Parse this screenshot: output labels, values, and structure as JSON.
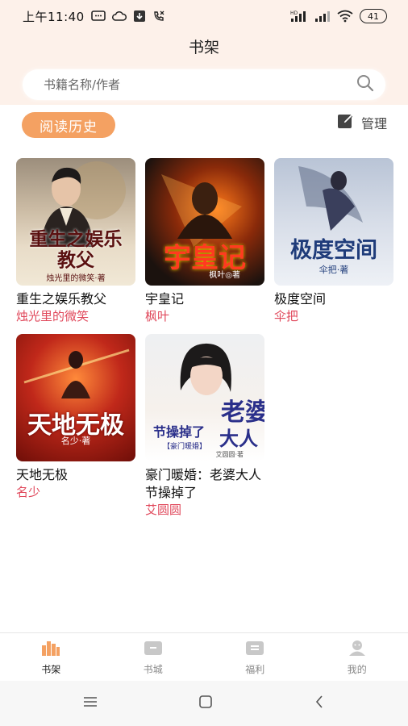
{
  "status_bar": {
    "time": "上午11:40",
    "network_label": "HD",
    "battery": "41"
  },
  "page_title": "书架",
  "search": {
    "placeholder": "书籍名称/作者"
  },
  "history_button": "阅读历史",
  "manage_button": "管理",
  "books": [
    {
      "title": "重生之娱乐教父",
      "author": "烛光里的微笑",
      "cover_title": "重生之娱乐教父",
      "cover_author": "烛光里的微笑·著"
    },
    {
      "title": "宇皇记",
      "author": "枫叶",
      "cover_title": "宇皇记",
      "cover_author": "枫叶◎著"
    },
    {
      "title": "极度空间",
      "author": "伞把",
      "cover_title": "极度空间",
      "cover_author": "伞把·著"
    },
    {
      "title": "天地无极",
      "author": "名少",
      "cover_title": "天地无极",
      "cover_author": "名少·著"
    },
    {
      "title": "豪门暖婚：老婆大人节操掉了",
      "author": "艾圆圆",
      "cover_title_a": "老婆",
      "cover_title_b": "节操掉了",
      "cover_title_c": "大人",
      "cover_series": "【豪门暖婚】",
      "cover_author": "艾圆圆·著"
    }
  ],
  "bottom_nav": [
    {
      "label": "书架",
      "icon": "bookshelf-icon",
      "active": true
    },
    {
      "label": "书城",
      "icon": "bookstore-icon",
      "active": false
    },
    {
      "label": "福利",
      "icon": "welfare-icon",
      "active": false
    },
    {
      "label": "我的",
      "icon": "profile-icon",
      "active": false
    }
  ],
  "colors": {
    "accent": "#f4a162",
    "author": "#e0485b",
    "header_bg": "#fdf1ea"
  }
}
